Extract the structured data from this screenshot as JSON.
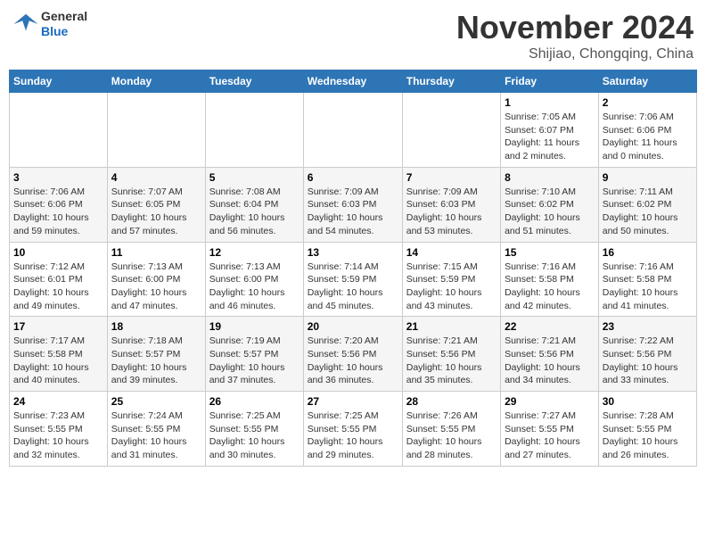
{
  "header": {
    "logo_line1": "General",
    "logo_line2": "Blue",
    "month": "November 2024",
    "location": "Shijiao, Chongqing, China"
  },
  "weekdays": [
    "Sunday",
    "Monday",
    "Tuesday",
    "Wednesday",
    "Thursday",
    "Friday",
    "Saturday"
  ],
  "weeks": [
    [
      {
        "day": "",
        "info": ""
      },
      {
        "day": "",
        "info": ""
      },
      {
        "day": "",
        "info": ""
      },
      {
        "day": "",
        "info": ""
      },
      {
        "day": "",
        "info": ""
      },
      {
        "day": "1",
        "info": "Sunrise: 7:05 AM\nSunset: 6:07 PM\nDaylight: 11 hours and 2 minutes."
      },
      {
        "day": "2",
        "info": "Sunrise: 7:06 AM\nSunset: 6:06 PM\nDaylight: 11 hours and 0 minutes."
      }
    ],
    [
      {
        "day": "3",
        "info": "Sunrise: 7:06 AM\nSunset: 6:06 PM\nDaylight: 10 hours and 59 minutes."
      },
      {
        "day": "4",
        "info": "Sunrise: 7:07 AM\nSunset: 6:05 PM\nDaylight: 10 hours and 57 minutes."
      },
      {
        "day": "5",
        "info": "Sunrise: 7:08 AM\nSunset: 6:04 PM\nDaylight: 10 hours and 56 minutes."
      },
      {
        "day": "6",
        "info": "Sunrise: 7:09 AM\nSunset: 6:03 PM\nDaylight: 10 hours and 54 minutes."
      },
      {
        "day": "7",
        "info": "Sunrise: 7:09 AM\nSunset: 6:03 PM\nDaylight: 10 hours and 53 minutes."
      },
      {
        "day": "8",
        "info": "Sunrise: 7:10 AM\nSunset: 6:02 PM\nDaylight: 10 hours and 51 minutes."
      },
      {
        "day": "9",
        "info": "Sunrise: 7:11 AM\nSunset: 6:02 PM\nDaylight: 10 hours and 50 minutes."
      }
    ],
    [
      {
        "day": "10",
        "info": "Sunrise: 7:12 AM\nSunset: 6:01 PM\nDaylight: 10 hours and 49 minutes."
      },
      {
        "day": "11",
        "info": "Sunrise: 7:13 AM\nSunset: 6:00 PM\nDaylight: 10 hours and 47 minutes."
      },
      {
        "day": "12",
        "info": "Sunrise: 7:13 AM\nSunset: 6:00 PM\nDaylight: 10 hours and 46 minutes."
      },
      {
        "day": "13",
        "info": "Sunrise: 7:14 AM\nSunset: 5:59 PM\nDaylight: 10 hours and 45 minutes."
      },
      {
        "day": "14",
        "info": "Sunrise: 7:15 AM\nSunset: 5:59 PM\nDaylight: 10 hours and 43 minutes."
      },
      {
        "day": "15",
        "info": "Sunrise: 7:16 AM\nSunset: 5:58 PM\nDaylight: 10 hours and 42 minutes."
      },
      {
        "day": "16",
        "info": "Sunrise: 7:16 AM\nSunset: 5:58 PM\nDaylight: 10 hours and 41 minutes."
      }
    ],
    [
      {
        "day": "17",
        "info": "Sunrise: 7:17 AM\nSunset: 5:58 PM\nDaylight: 10 hours and 40 minutes."
      },
      {
        "day": "18",
        "info": "Sunrise: 7:18 AM\nSunset: 5:57 PM\nDaylight: 10 hours and 39 minutes."
      },
      {
        "day": "19",
        "info": "Sunrise: 7:19 AM\nSunset: 5:57 PM\nDaylight: 10 hours and 37 minutes."
      },
      {
        "day": "20",
        "info": "Sunrise: 7:20 AM\nSunset: 5:56 PM\nDaylight: 10 hours and 36 minutes."
      },
      {
        "day": "21",
        "info": "Sunrise: 7:21 AM\nSunset: 5:56 PM\nDaylight: 10 hours and 35 minutes."
      },
      {
        "day": "22",
        "info": "Sunrise: 7:21 AM\nSunset: 5:56 PM\nDaylight: 10 hours and 34 minutes."
      },
      {
        "day": "23",
        "info": "Sunrise: 7:22 AM\nSunset: 5:56 PM\nDaylight: 10 hours and 33 minutes."
      }
    ],
    [
      {
        "day": "24",
        "info": "Sunrise: 7:23 AM\nSunset: 5:55 PM\nDaylight: 10 hours and 32 minutes."
      },
      {
        "day": "25",
        "info": "Sunrise: 7:24 AM\nSunset: 5:55 PM\nDaylight: 10 hours and 31 minutes."
      },
      {
        "day": "26",
        "info": "Sunrise: 7:25 AM\nSunset: 5:55 PM\nDaylight: 10 hours and 30 minutes."
      },
      {
        "day": "27",
        "info": "Sunrise: 7:25 AM\nSunset: 5:55 PM\nDaylight: 10 hours and 29 minutes."
      },
      {
        "day": "28",
        "info": "Sunrise: 7:26 AM\nSunset: 5:55 PM\nDaylight: 10 hours and 28 minutes."
      },
      {
        "day": "29",
        "info": "Sunrise: 7:27 AM\nSunset: 5:55 PM\nDaylight: 10 hours and 27 minutes."
      },
      {
        "day": "30",
        "info": "Sunrise: 7:28 AM\nSunset: 5:55 PM\nDaylight: 10 hours and 26 minutes."
      }
    ]
  ]
}
